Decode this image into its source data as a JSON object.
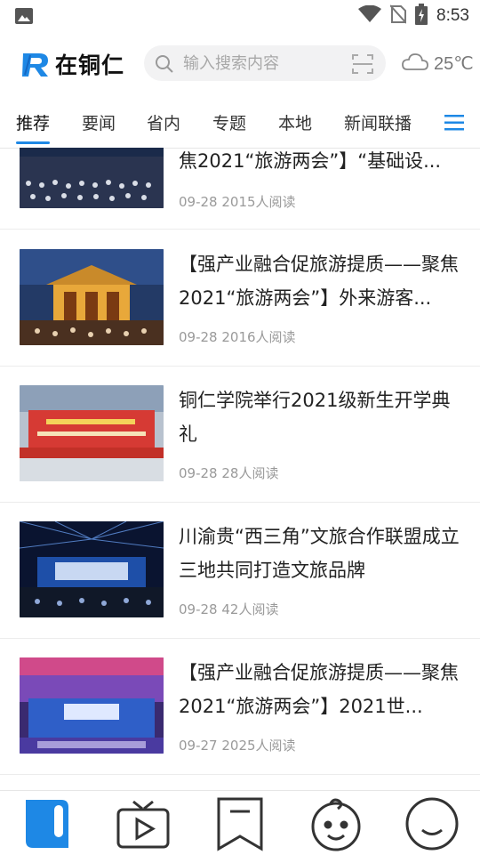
{
  "status_bar": {
    "time": "8:53",
    "icons": [
      "image-icon",
      "wifi-icon",
      "no-sim-icon",
      "battery-charging-icon"
    ]
  },
  "header": {
    "logo_text": "在铜仁",
    "search_placeholder": "输入搜索内容",
    "weather_temp": "25℃",
    "weather_icon": "cloud-icon"
  },
  "tabs": [
    "推荐",
    "要闻",
    "省内",
    "专题",
    "本地",
    "新闻联播"
  ],
  "active_tab": "推荐",
  "accent_color": "#1e88e5",
  "feed": [
    {
      "title": "焦2021“旅游两会”】“基础设...",
      "date": "09-28",
      "reads": "2015人阅读"
    },
    {
      "title": "【强产业融合促旅游提质——聚焦2021“旅游两会”】外来游客...",
      "date": "09-28",
      "reads": "2016人阅读"
    },
    {
      "title": "铜仁学院举行2021级新生开学典礼",
      "date": "09-28",
      "reads": "28人阅读"
    },
    {
      "title": "川渝贵“西三角”文旅合作联盟成立 三地共同打造文旅品牌",
      "date": "09-28",
      "reads": "42人阅读"
    },
    {
      "title": "【强产业融合促旅游提质——聚焦2021“旅游两会”】2021世...",
      "date": "09-27",
      "reads": "2025人阅读"
    }
  ],
  "bottom_nav": [
    "news-book-icon",
    "tv-icon",
    "bookmark-icon",
    "baby-face-icon",
    "smile-face-icon"
  ]
}
